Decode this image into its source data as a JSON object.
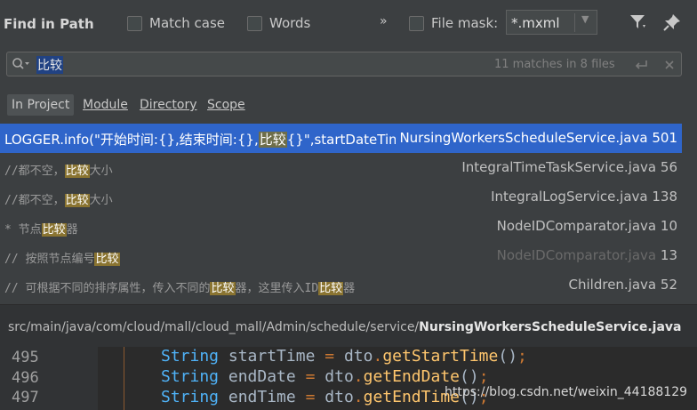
{
  "header": {
    "title": "Find in Path",
    "match_case": "Match case",
    "words": "Words",
    "chevron": "»",
    "file_mask_label": "File mask:",
    "file_mask_value": "*.mxml"
  },
  "search": {
    "query": "比较",
    "matches": "11 matches in 8 files"
  },
  "scope_tabs": [
    "In Project",
    "Module",
    "Directory",
    "Scope"
  ],
  "results": [
    {
      "code_pre": "LOGGER.info(\"开始时间:{},结束时间:{},",
      "match": "比较",
      "code_post": "{}\",startDateTim",
      "file": "NursingWorkersScheduleService.java",
      "line": "501",
      "selected": true
    },
    {
      "code_pre": "//都不空，",
      "match": "比较",
      "code_post": "大小",
      "file": "IntegralTimeTaskService.java",
      "line": "56"
    },
    {
      "code_pre": "//都不空，",
      "match": "比较",
      "code_post": "大小",
      "file": "IntegralLogService.java",
      "line": "138"
    },
    {
      "code_pre": "* 节点",
      "match": "比较",
      "code_post": "器",
      "file": "NodeIDComparator.java",
      "line": "10"
    },
    {
      "code_pre": "// 按照节点编号",
      "match": "比较",
      "code_post": "",
      "file": "NodeIDComparator.java",
      "line": "13",
      "dim": true
    },
    {
      "code_pre": "// 可根据不同的排序属性，传入不同的",
      "match": "比较",
      "code_post": "器，这里传入ID",
      "match2": "比较",
      "code_post2": "器",
      "file": "Children.java",
      "line": "52"
    }
  ],
  "path": {
    "dir": "src/main/java/com/cloud/mall/cloud_mall/Admin/schedule/service/",
    "file": "NursingWorkersScheduleService.java"
  },
  "editor": {
    "lines": [
      {
        "num": "495",
        "type": "String",
        "var": "startTime",
        "eq": "=",
        "obj": "dto",
        "dot": ".",
        "method": "getStartTime",
        "paren": "()",
        "semi": ";"
      },
      {
        "num": "496",
        "type": "String",
        "var": "endDate",
        "eq": "=",
        "obj": "dto",
        "dot": ".",
        "method": "getEndDate",
        "paren": "()",
        "semi": ";"
      },
      {
        "num": "497",
        "type": "String",
        "var": "endTime",
        "eq": "=",
        "obj": "dto",
        "dot": ".",
        "method": "getEndTime",
        "paren": "()",
        "semi": ";"
      }
    ]
  },
  "watermark": "https://blog.csdn.net/weixin_44188129"
}
